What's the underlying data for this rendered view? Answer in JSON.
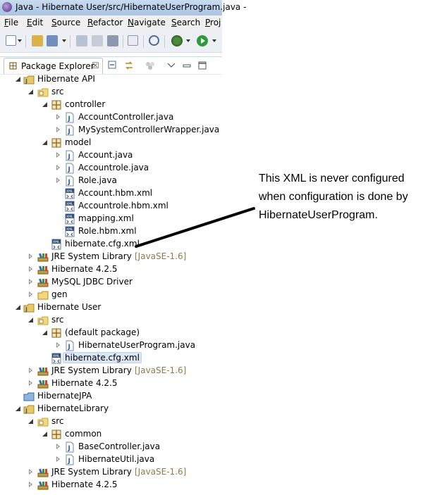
{
  "window": {
    "title": "Java - Hibernate User/src/HibernateUserProgram.java -"
  },
  "menu": [
    "File",
    "Edit",
    "Source",
    "Refactor",
    "Navigate",
    "Search",
    "Proj"
  ],
  "view": {
    "tab_label": "Package Explorer",
    "close_glyph": "☒"
  },
  "colors": {
    "source_folder": "#c8a436",
    "package": "#8a6a2a",
    "java_blue": "#2f5fa8",
    "library": "#3a6aa8"
  },
  "tree": [
    {
      "label": "Hibernate API",
      "icon": "java-project-icon",
      "depth": 0,
      "state": "expanded"
    },
    {
      "label": "src",
      "icon": "source-folder-icon",
      "depth": 1,
      "state": "expanded"
    },
    {
      "label": "controller",
      "icon": "package-icon",
      "depth": 2,
      "state": "expanded"
    },
    {
      "label": "AccountController.java",
      "icon": "java-file-icon",
      "depth": 3,
      "state": "collapsed"
    },
    {
      "label": "MySystemControllerWrapper.java",
      "icon": "java-file-icon",
      "depth": 3,
      "state": "collapsed"
    },
    {
      "label": "model",
      "icon": "package-icon",
      "depth": 2,
      "state": "expanded"
    },
    {
      "label": "Account.java",
      "icon": "java-file-icon",
      "depth": 3,
      "state": "collapsed"
    },
    {
      "label": "Accountrole.java",
      "icon": "java-file-icon",
      "depth": 3,
      "state": "collapsed"
    },
    {
      "label": "Role.java",
      "icon": "java-file-icon",
      "depth": 3,
      "state": "collapsed"
    },
    {
      "label": "Account.hbm.xml",
      "icon": "xml-file-icon",
      "depth": 3,
      "state": "leaf"
    },
    {
      "label": "Accountrole.hbm.xml",
      "icon": "xml-file-icon",
      "depth": 3,
      "state": "leaf"
    },
    {
      "label": "mapping.xml",
      "icon": "xml-file-icon",
      "depth": 3,
      "state": "leaf"
    },
    {
      "label": "Role.hbm.xml",
      "icon": "xml-file-icon",
      "depth": 3,
      "state": "leaf"
    },
    {
      "label": "hibernate.cfg.xml",
      "icon": "xml-file-icon",
      "depth": 2,
      "state": "leaf"
    },
    {
      "label": "JRE System Library",
      "decoration": "[JavaSE-1.6]",
      "icon": "library-icon",
      "depth": 1,
      "state": "collapsed"
    },
    {
      "label": "Hibernate 4.2.5",
      "icon": "library-icon",
      "depth": 1,
      "state": "collapsed"
    },
    {
      "label": "MySQL JDBC Driver",
      "icon": "library-icon",
      "depth": 1,
      "state": "collapsed"
    },
    {
      "label": "gen",
      "icon": "folder-icon",
      "depth": 1,
      "state": "collapsed"
    },
    {
      "label": "Hibernate User",
      "icon": "java-project-icon",
      "depth": 0,
      "state": "expanded"
    },
    {
      "label": "src",
      "icon": "source-folder-icon",
      "depth": 1,
      "state": "expanded"
    },
    {
      "label": "(default package)",
      "icon": "package-icon",
      "depth": 2,
      "state": "expanded"
    },
    {
      "label": "HibernateUserProgram.java",
      "icon": "java-file-icon",
      "depth": 3,
      "state": "collapsed"
    },
    {
      "label": "hibernate.cfg.xml",
      "icon": "xml-file-icon",
      "depth": 2,
      "state": "leaf",
      "selected": true
    },
    {
      "label": "JRE System Library",
      "decoration": "[JavaSE-1.6]",
      "icon": "library-icon",
      "depth": 1,
      "state": "collapsed"
    },
    {
      "label": "Hibernate 4.2.5",
      "icon": "library-icon",
      "depth": 1,
      "state": "collapsed"
    },
    {
      "label": "HibernateJPA",
      "icon": "closed-project-icon",
      "depth": 0,
      "state": "leaf"
    },
    {
      "label": "HibernateLibrary",
      "icon": "java-project-icon",
      "depth": 0,
      "state": "expanded"
    },
    {
      "label": "src",
      "icon": "source-folder-icon",
      "depth": 1,
      "state": "expanded"
    },
    {
      "label": "common",
      "icon": "package-icon",
      "depth": 2,
      "state": "expanded"
    },
    {
      "label": "BaseController.java",
      "icon": "java-file-icon",
      "depth": 3,
      "state": "collapsed"
    },
    {
      "label": "HibernateUtil.java",
      "icon": "java-file-icon",
      "depth": 3,
      "state": "collapsed"
    },
    {
      "label": "JRE System Library",
      "decoration": "[JavaSE-1.6]",
      "icon": "library-icon",
      "depth": 1,
      "state": "collapsed"
    },
    {
      "label": "Hibernate 4.2.5",
      "icon": "library-icon",
      "depth": 1,
      "state": "collapsed"
    }
  ],
  "annotation": {
    "lines": [
      "This XML is never configured",
      "when configuration is done by",
      "HibernateUserProgram."
    ]
  }
}
